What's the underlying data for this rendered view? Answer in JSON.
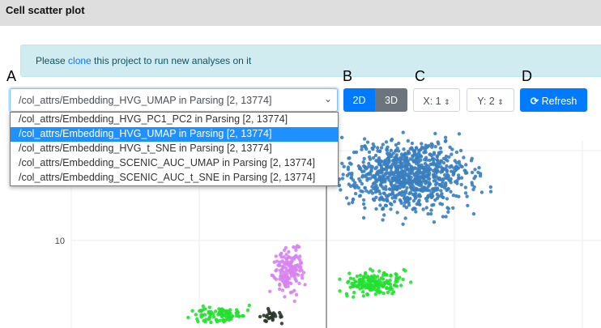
{
  "header": {
    "title": "Cell scatter plot"
  },
  "alert": {
    "before": "Please ",
    "link": "clone",
    "after": " this project to run new analyses on it"
  },
  "labels": {
    "a": "A",
    "b": "B",
    "c": "C",
    "d": "D"
  },
  "embedding_select": {
    "value": "/col_attrs/Embedding_HVG_UMAP in Parsing [2, 13774]",
    "options": [
      "/col_attrs/Embedding_HVG_PC1_PC2 in Parsing [2, 13774]",
      "/col_attrs/Embedding_HVG_UMAP in Parsing [2, 13774]",
      "/col_attrs/Embedding_HVG_t_SNE in Parsing [2, 13774]",
      "/col_attrs/Embedding_SCENIC_AUC_UMAP in Parsing [2, 13774]",
      "/col_attrs/Embedding_SCENIC_AUC_t_SNE in Parsing [2, 13774]"
    ],
    "selected_index": 1
  },
  "toolbar": {
    "btn_2d": "2D",
    "btn_3d": "3D",
    "active_mode": "2D",
    "x_label": "X: 1",
    "y_label": "Y: 2",
    "refresh": "Refresh",
    "refresh_icon": "refresh-icon"
  },
  "colors": {
    "primary": "#007bff",
    "secondary": "#6c757d"
  },
  "chart_data": {
    "type": "scatter",
    "y_ticks": [
      "10"
    ],
    "grid": true,
    "clusters": [
      {
        "color": "#3a7ebf",
        "center": [
          3.2,
          13.6
        ],
        "spread": [
          1.9,
          1.5
        ],
        "count": 900
      },
      {
        "color": "#d783f0",
        "center": [
          -1.5,
          8.4
        ],
        "spread": [
          0.45,
          1.0
        ],
        "count": 150
      },
      {
        "color": "#22e030",
        "center": [
          1.8,
          7.6
        ],
        "spread": [
          0.9,
          0.55
        ],
        "count": 160
      },
      {
        "color": "#22e030",
        "center": [
          -4.2,
          5.9
        ],
        "spread": [
          0.8,
          0.35
        ],
        "count": 90
      },
      {
        "color": "#2b3a2e",
        "center": [
          -2.1,
          5.8
        ],
        "spread": [
          0.35,
          0.3
        ],
        "count": 30
      }
    ]
  }
}
